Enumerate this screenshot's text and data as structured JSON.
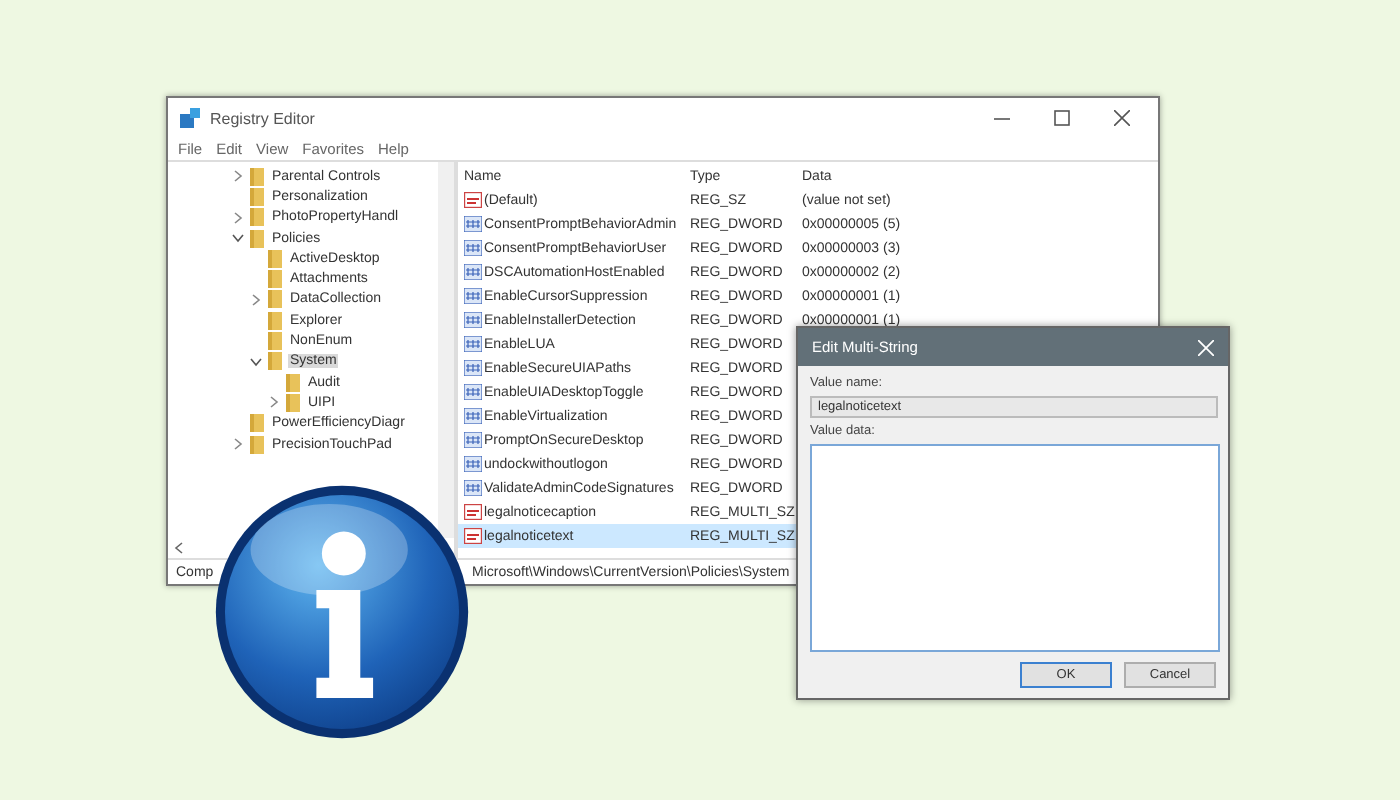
{
  "window": {
    "title": "Registry Editor"
  },
  "menu": [
    "File",
    "Edit",
    "View",
    "Favorites",
    "Help"
  ],
  "tree": [
    {
      "label": "Parental Controls",
      "expanded": false,
      "selected": false
    },
    {
      "label": "Personalization",
      "selected": false
    },
    {
      "label": "PhotoPropertyHandl",
      "expanded": false,
      "selected": false
    },
    {
      "label": "Policies",
      "expanded": true,
      "selected": false,
      "children": [
        {
          "label": "ActiveDesktop",
          "selected": false
        },
        {
          "label": "Attachments",
          "selected": false
        },
        {
          "label": "DataCollection",
          "expanded": false,
          "selected": false
        },
        {
          "label": "Explorer",
          "selected": false
        },
        {
          "label": "NonEnum",
          "selected": false
        },
        {
          "label": "System",
          "expanded": true,
          "selected": true,
          "children": [
            {
              "label": "Audit",
              "selected": false
            },
            {
              "label": "UIPI",
              "expanded": false,
              "selected": false
            }
          ]
        }
      ]
    },
    {
      "label": "PowerEfficiencyDiagr",
      "selected": false
    },
    {
      "label": "PrecisionTouchPad",
      "expanded": false,
      "selected": false
    }
  ],
  "table": {
    "columns": [
      "Name",
      "Type",
      "Data"
    ],
    "rows": [
      {
        "kind": "string",
        "name": "(Default)",
        "type": "REG_SZ",
        "data": "(value not set)",
        "selected": false
      },
      {
        "kind": "dword",
        "name": "ConsentPromptBehaviorAdmin",
        "type": "REG_DWORD",
        "data": "0x00000005 (5)",
        "selected": false
      },
      {
        "kind": "dword",
        "name": "ConsentPromptBehaviorUser",
        "type": "REG_DWORD",
        "data": "0x00000003 (3)",
        "selected": false
      },
      {
        "kind": "dword",
        "name": "DSCAutomationHostEnabled",
        "type": "REG_DWORD",
        "data": "0x00000002 (2)",
        "selected": false
      },
      {
        "kind": "dword",
        "name": "EnableCursorSuppression",
        "type": "REG_DWORD",
        "data": "0x00000001 (1)",
        "selected": false
      },
      {
        "kind": "dword",
        "name": "EnableInstallerDetection",
        "type": "REG_DWORD",
        "data": "0x00000001 (1)",
        "selected": false
      },
      {
        "kind": "dword",
        "name": "EnableLUA",
        "type": "REG_DWORD",
        "selected": false
      },
      {
        "kind": "dword",
        "name": "EnableSecureUIAPaths",
        "type": "REG_DWORD",
        "selected": false
      },
      {
        "kind": "dword",
        "name": "EnableUIADesktopToggle",
        "type": "REG_DWORD",
        "selected": false
      },
      {
        "kind": "dword",
        "name": "EnableVirtualization",
        "type": "REG_DWORD",
        "selected": false
      },
      {
        "kind": "dword",
        "name": "PromptOnSecureDesktop",
        "type": "REG_DWORD",
        "selected": false
      },
      {
        "kind": "dword",
        "name": "undockwithoutlogon",
        "type": "REG_DWORD",
        "selected": false
      },
      {
        "kind": "dword",
        "name": "ValidateAdminCodeSignatures",
        "type": "REG_DWORD",
        "selected": false
      },
      {
        "kind": "string",
        "name": "legalnoticecaption",
        "type": "REG_MULTI_SZ",
        "selected": false
      },
      {
        "kind": "string",
        "name": "legalnoticetext",
        "type": "REG_MULTI_SZ",
        "selected": true
      }
    ]
  },
  "status_bar": [
    "Comp",
    "Microsoft\\Windows\\CurrentVersion\\Policies\\System"
  ],
  "dialog": {
    "title": "Edit Multi-String",
    "name_label": "Value name:",
    "name_value": "legalnoticetext",
    "data_label": "Value data:",
    "buttons": [
      "OK",
      "Cancel"
    ]
  }
}
